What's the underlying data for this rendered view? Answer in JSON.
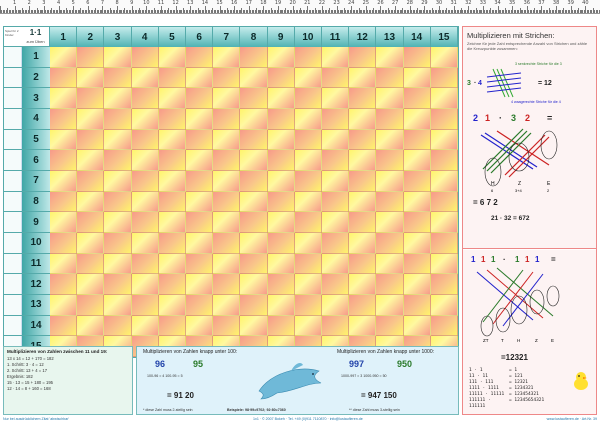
{
  "ruler": {
    "labels": [
      "1",
      "2",
      "3",
      "4",
      "5",
      "6",
      "7",
      "8",
      "9",
      "10",
      "11",
      "12",
      "13",
      "14",
      "15",
      "16",
      "17",
      "18",
      "19",
      "20",
      "21",
      "22",
      "23",
      "24",
      "25",
      "26",
      "27",
      "28",
      "29",
      "30",
      "31",
      "32",
      "33",
      "34",
      "35",
      "36",
      "37",
      "38",
      "39",
      "40"
    ]
  },
  "table": {
    "corner_title": "1·1",
    "corner_sub": "zum Üben",
    "corner_tiny": "Spiel für 2 Kinder",
    "columns": [
      "1",
      "2",
      "3",
      "4",
      "5",
      "6",
      "7",
      "8",
      "9",
      "10",
      "11",
      "12",
      "13",
      "14",
      "15"
    ],
    "rows": [
      "1",
      "2",
      "3",
      "4",
      "5",
      "6",
      "7",
      "8",
      "9",
      "10",
      "11",
      "12",
      "13",
      "14",
      "15"
    ]
  },
  "right": {
    "title": "Multiplizieren mit Strichen:",
    "sub": "Zeichne für jede Zahl entsprechende Anzahl von Strichen und zähle die Kreuzpunkte zusammen:",
    "ex1": {
      "text": "3 · 4 = 12",
      "note1": "3 senkrechte Striche für die 3",
      "note2": "4 waagerechte Striche für die 4"
    },
    "ex2": {
      "top": "2 1 · 3 2 =",
      "labels": [
        "H",
        "Z",
        "E"
      ],
      "sums": [
        "6",
        "3+4",
        "2"
      ],
      "result": "= 6  7  2",
      "equation": "21 · 32 = 672"
    },
    "ex3": {
      "top": "1 1 1 · 1 1 1 =",
      "labels": [
        "ZT",
        "T",
        "H",
        "Z",
        "E"
      ],
      "result": "=12321"
    },
    "lines": [
      {
        "left": "1 · 1",
        "right": "= 1"
      },
      {
        "left": "11 · 11",
        "right": "= 121"
      },
      {
        "left": "111 · 111",
        "right": "= 12321"
      },
      {
        "left": "1111 · 1111",
        "right": "= 1234321"
      },
      {
        "left": "11111 · 11111",
        "right": "= 123454321"
      },
      {
        "left": "111111 · 111111",
        "right": "= 12345654321"
      }
    ]
  },
  "bottom_left": {
    "title": "Multiplizieren von Zahlen zwischen 11 und 19:",
    "l1": "13 x 14 = 12 + 170 = 182",
    "l2": "1. Schritt: 3 · 4 = 12",
    "l3": "2. Schritt: 13 + 4 = 17",
    "l4": "Ergebnis: 182",
    "l5": "15 · 13 = 15 + 180 = 195",
    "l6": "12 · 14 = 8 + 160 = 168"
  },
  "bottom_mid": {
    "head_left": "Multiplizieren von Zahlen knapp unter 100:",
    "head_right": "Multiplizieren von Zahlen knapp unter 1000:",
    "a1": "96",
    "a2": "95",
    "a_steps": "100-96 = 4    100-95 = 5",
    "a_res": "= 91 20",
    "b1": "997",
    "b2": "950",
    "b_steps": "1000-997 = 3    1000-950 = 50",
    "b_res": "= 947 150",
    "foot_left": "* diese Zahl muss 2-stellig sein",
    "foot_mid": "Beispiele: 98·99=9702; 92·80=7360",
    "foot_right": "** diese Zahl muss 3-stellig sein"
  },
  "footer": {
    "left": "Nur bei ausdrücklichem Zitat 'abwischbar'",
    "mid": "1x1 · © 2007 Bokeh · Tel. +49 (0)911 7110870 · info@lustaufleren.de",
    "right": "www.lustaufleren.de · Art.Nr. 39"
  },
  "colors": {
    "teal": "#4fb3b3",
    "yellow": "#fff46a",
    "salmon": "#f79a8a"
  }
}
